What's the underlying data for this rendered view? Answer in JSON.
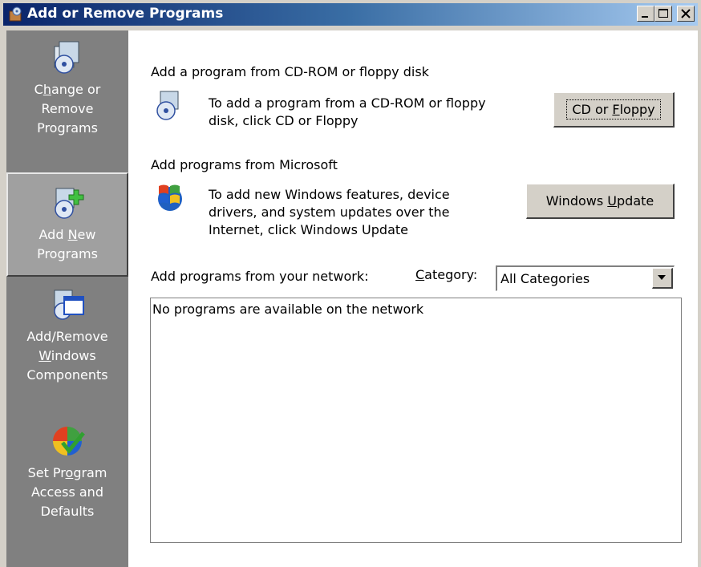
{
  "window": {
    "title": "Add or Remove Programs",
    "controls": {
      "minimize": "minimize",
      "maximize": "maximize",
      "close": "close"
    }
  },
  "sidebar": {
    "items": [
      {
        "line1_pre": "C",
        "line1_ul": "h",
        "line1_post": "ange or",
        "line2": "Remove",
        "line3": "Programs",
        "icon": "change-remove-icon"
      },
      {
        "line1": "Add ",
        "line1_ul": "N",
        "line1_post": "ew",
        "line2": "Programs",
        "icon": "add-new-programs-icon",
        "selected": true
      },
      {
        "line1": "Add/Remove",
        "line2_ul": "W",
        "line2_post": "indows",
        "line3": "Components",
        "icon": "windows-components-icon"
      },
      {
        "line1_pre": "Set Pr",
        "line1_ul": "o",
        "line1_post": "gram",
        "line2": "Access and",
        "line3": "Defaults",
        "icon": "program-access-icon"
      }
    ]
  },
  "main": {
    "cd_section": {
      "title": "Add a program from CD-ROM or floppy disk",
      "desc_line1": "To add a program from a CD-ROM or floppy",
      "desc_line2": "disk, click CD or Floppy",
      "button_pre": "CD or ",
      "button_ul": "F",
      "button_post": "loppy"
    },
    "ms_section": {
      "title": "Add programs from Microsoft",
      "desc_line1": "To add new Windows features, device",
      "desc_line2": "drivers, and system updates over the",
      "desc_line3": "Internet, click Windows Update",
      "button_pre": "Windows ",
      "button_ul": "U",
      "button_post": "pdate"
    },
    "network_section": {
      "title": "Add programs from your network:",
      "category_ul": "C",
      "category_post": "ategory:",
      "category_value": "All Categories",
      "empty_message": "No programs are available on the network"
    }
  }
}
